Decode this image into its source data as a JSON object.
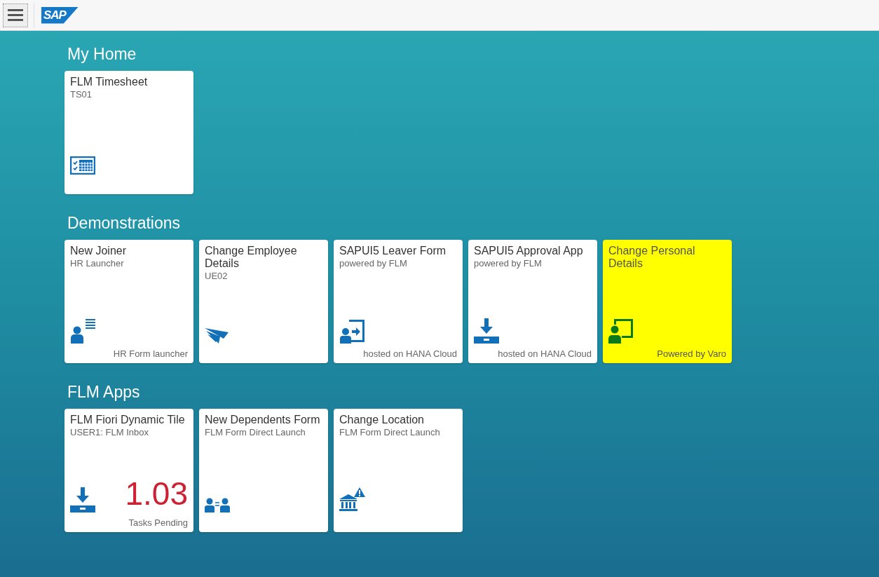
{
  "header": {
    "logo": "SAP"
  },
  "groups": [
    {
      "title": "My Home",
      "tiles": [
        {
          "title": "FLM Timesheet",
          "subtitle": "TS01",
          "kind": "timesheet",
          "highlighted": false
        }
      ]
    },
    {
      "title": "Demonstrations",
      "tiles": [
        {
          "title": "New Joiner",
          "subtitle": "HR Launcher",
          "kind": "joiner",
          "footer": "HR Form launcher",
          "highlighted": false
        },
        {
          "title": "Change Employee Details",
          "subtitle": "UE02",
          "kind": "send",
          "highlighted": false
        },
        {
          "title": "SAPUI5 Leaver Form",
          "subtitle": "powered by FLM",
          "kind": "leaver",
          "footer": "hosted on HANA Cloud",
          "highlighted": false
        },
        {
          "title": "SAPUI5 Approval App",
          "subtitle": "powered by FLM",
          "kind": "inbox",
          "footer": "hosted on HANA Cloud",
          "highlighted": false
        },
        {
          "title": "Change Personal Details",
          "kind": "personal",
          "footer": "Powered by Varo",
          "highlighted": true
        }
      ]
    },
    {
      "title": "FLM Apps",
      "tiles": [
        {
          "title": "FLM Fiori Dynamic Tile",
          "subtitle": "USER1: FLM Inbox",
          "kind": "inbox",
          "number": "1.03",
          "footer": "Tasks Pending",
          "highlighted": false
        },
        {
          "title": "New Dependents Form",
          "subtitle": "FLM Form Direct Launch",
          "kind": "dependents",
          "highlighted": false
        },
        {
          "title": "Change Location",
          "subtitle": "FLM Form Direct Launch",
          "kind": "location",
          "highlighted": false
        }
      ]
    }
  ]
}
